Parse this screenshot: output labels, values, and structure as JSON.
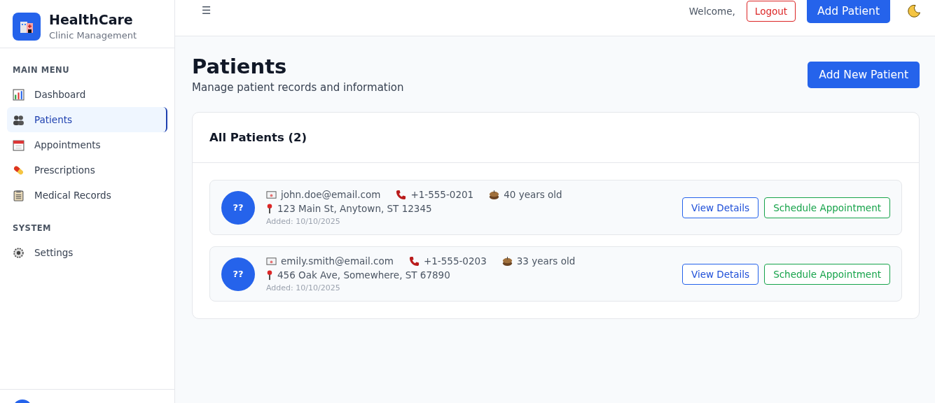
{
  "brand": {
    "title": "HealthCare",
    "subtitle": "Clinic Management"
  },
  "sidebar": {
    "sections": [
      {
        "heading": "MAIN MENU",
        "items": [
          {
            "label": "Dashboard",
            "selected": false
          },
          {
            "label": "Patients",
            "selected": true
          },
          {
            "label": "Appointments",
            "selected": false
          },
          {
            "label": "Prescriptions",
            "selected": false
          },
          {
            "label": "Medical Records",
            "selected": false
          }
        ]
      },
      {
        "heading": "SYSTEM",
        "items": [
          {
            "label": "Settings",
            "selected": false
          }
        ]
      }
    ]
  },
  "topbar": {
    "menu_glyph": "☰",
    "welcome": "Welcome,",
    "logout": "Logout",
    "add_patient": "Add Patient"
  },
  "page": {
    "title": "Patients",
    "subtitle": "Manage patient records and information",
    "add_button": "Add New Patient"
  },
  "list": {
    "title": "All Patients (2)",
    "patients": [
      {
        "initials": "??",
        "email": "john.doe@email.com",
        "phone": "+1-555-0201",
        "age": "40 years old",
        "address": "123 Main St, Anytown, ST 12345",
        "added": "Added: 10/10/2025",
        "view": "View Details",
        "schedule": "Schedule Appointment"
      },
      {
        "initials": "??",
        "email": "emily.smith@email.com",
        "phone": "+1-555-0203",
        "age": "33 years old",
        "address": "456 Oak Ave, Somewhere, ST 67890",
        "added": "Added: 10/10/2025",
        "view": "View Details",
        "schedule": "Schedule Appointment"
      }
    ]
  }
}
